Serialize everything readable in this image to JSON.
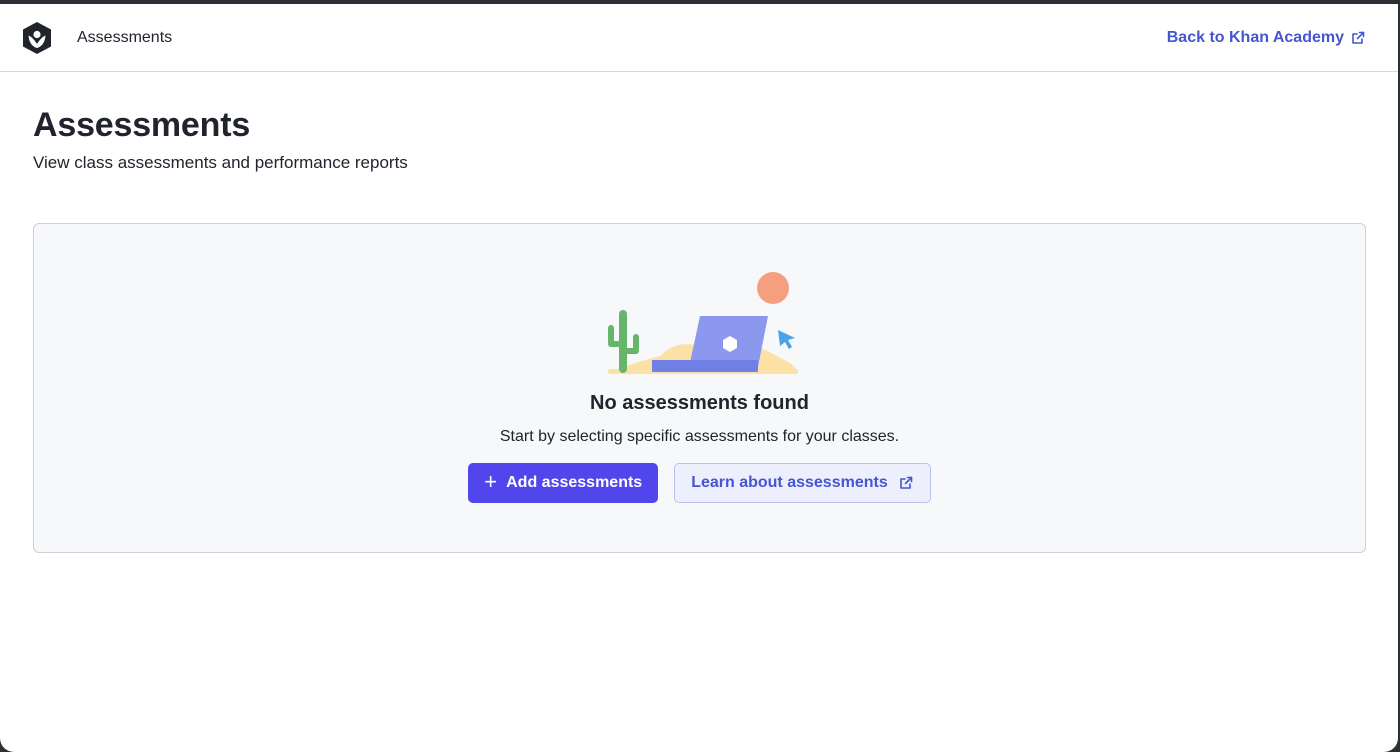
{
  "header": {
    "title": "Assessments",
    "back_link": "Back to Khan Academy",
    "logo_icon": "khan-academy-logo-icon",
    "external_icon": "external-link-icon"
  },
  "page": {
    "title": "Assessments",
    "subtitle": "View class assessments and performance reports"
  },
  "empty_state": {
    "illustration": "desert-laptop-illustration",
    "title": "No assessments found",
    "description": "Start by selecting specific assessments for your classes.",
    "primary_button": "Add assessments",
    "secondary_button": "Learn about assessments"
  },
  "colors": {
    "primary": "#5046ec",
    "link": "#4556cf",
    "panel_background": "#f7f8fa"
  }
}
